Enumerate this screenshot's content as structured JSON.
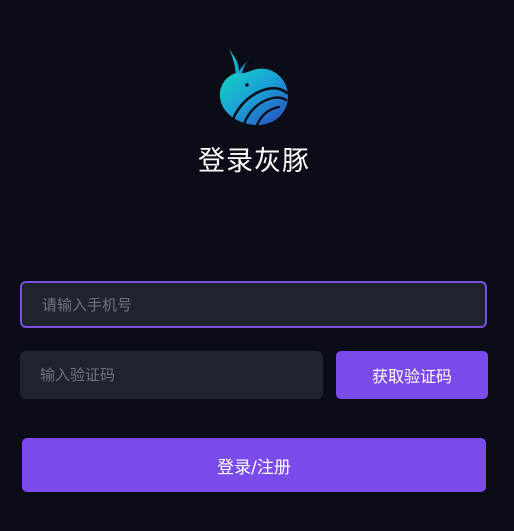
{
  "app": {
    "title": "登录灰豚",
    "logo_icon": "whale-logo-icon"
  },
  "form": {
    "phone": {
      "value": "",
      "placeholder": "请输入手机号"
    },
    "code": {
      "value": "",
      "placeholder": "输入验证码"
    },
    "get_code_label": "获取验证码",
    "submit_label": "登录/注册"
  },
  "colors": {
    "background": "#0a0d17",
    "accent": "#7b4aea",
    "input_bg": "#1f232d",
    "focus_border": "#7b4fe0"
  }
}
